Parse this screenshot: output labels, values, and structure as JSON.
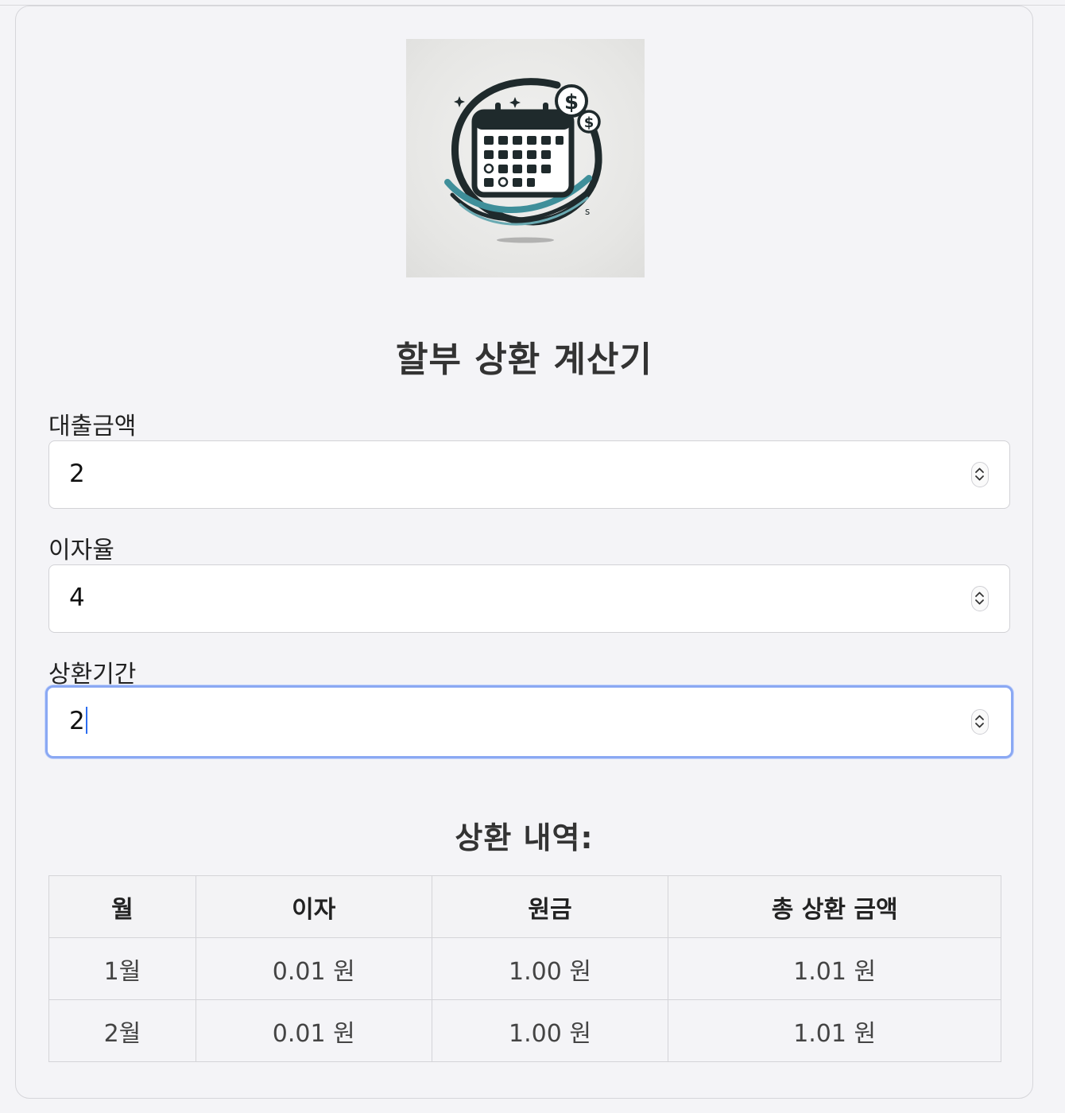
{
  "app": {
    "title": "할부 상환 계산기",
    "logo_icon": "calendar-coins-logo-icon"
  },
  "form": {
    "loan_amount": {
      "label": "대출금액",
      "value": "2"
    },
    "interest_rate": {
      "label": "이자율",
      "value": "4"
    },
    "term": {
      "label": "상환기간",
      "value": "2"
    }
  },
  "schedule": {
    "title": "상환 내역:",
    "headers": [
      "월",
      "이자",
      "원금",
      "총 상환 금액"
    ],
    "rows": [
      {
        "month": "1월",
        "interest": "0.01 원",
        "principal": "1.00 원",
        "total": "1.01 원"
      },
      {
        "month": "2월",
        "interest": "0.01 원",
        "principal": "1.00 원",
        "total": "1.01 원"
      }
    ]
  },
  "colors": {
    "focus_ring": "#8aa8f3",
    "caret": "#2b6df0",
    "logo_teal": "#3f8f9a",
    "logo_dark": "#1f2a2c"
  }
}
